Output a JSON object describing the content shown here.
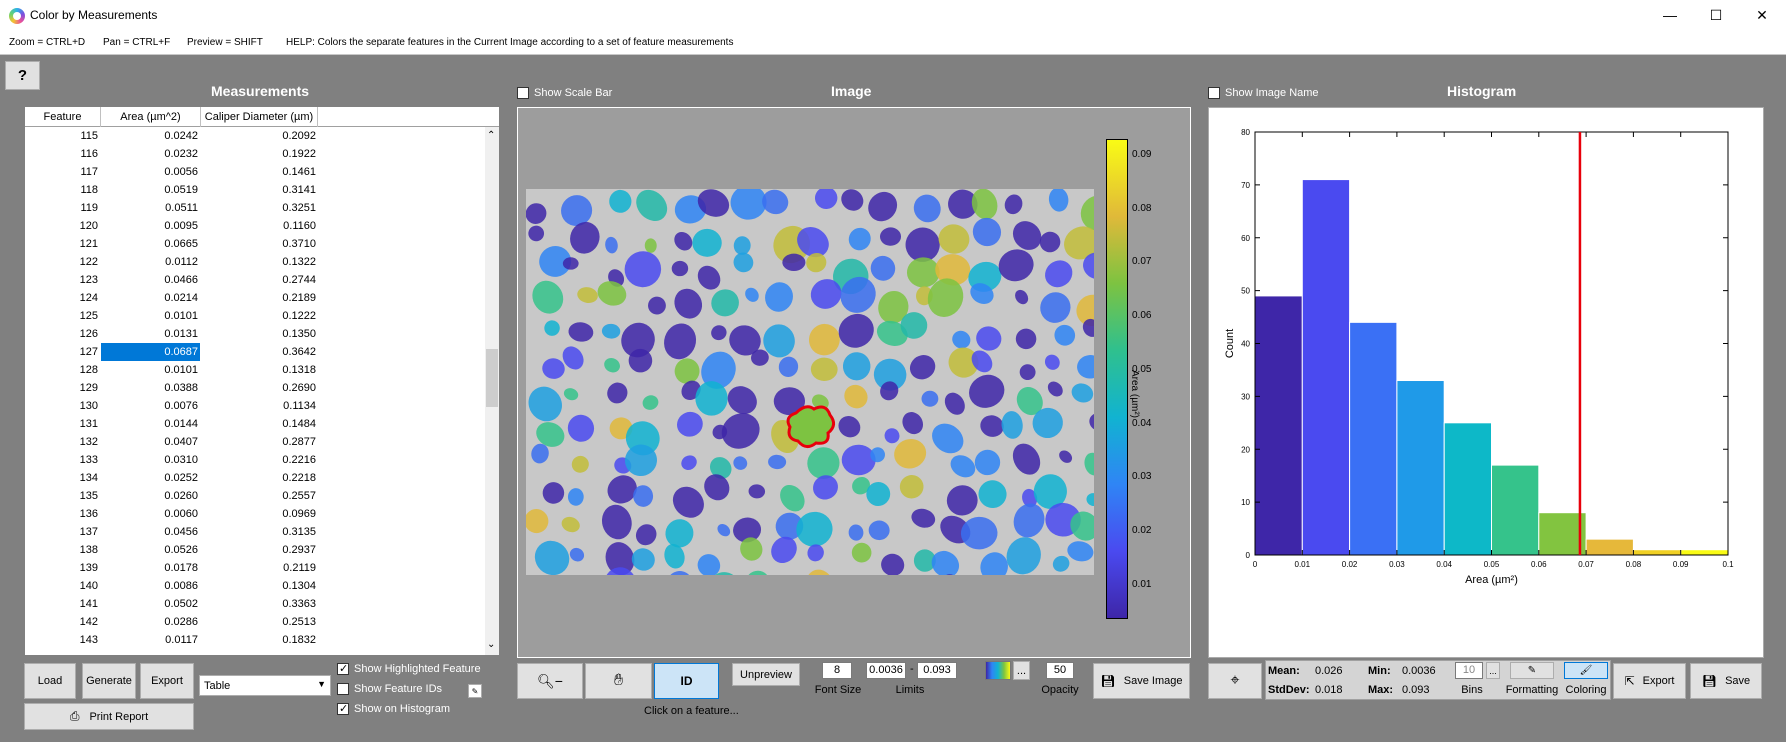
{
  "window": {
    "title": "Color by Measurements",
    "minimize": "—",
    "maximize": "☐",
    "close": "✕"
  },
  "hotkeys": {
    "zoom": "Zoom = CTRL+D",
    "pan": "Pan = CTRL+F",
    "preview": "Preview = SHIFT",
    "help": "HELP:  Colors the separate features in the Current Image according to a set of feature measurements"
  },
  "help_button": "?",
  "measurements": {
    "title": "Measurements",
    "columns": [
      "Feature",
      "Area (µm^2)",
      "Caliper Diameter (µm)"
    ],
    "rows": [
      [
        "115",
        "0.0242",
        "0.2092"
      ],
      [
        "116",
        "0.0232",
        "0.1922"
      ],
      [
        "117",
        "0.0056",
        "0.1461"
      ],
      [
        "118",
        "0.0519",
        "0.3141"
      ],
      [
        "119",
        "0.0511",
        "0.3251"
      ],
      [
        "120",
        "0.0095",
        "0.1160"
      ],
      [
        "121",
        "0.0665",
        "0.3710"
      ],
      [
        "122",
        "0.0112",
        "0.1322"
      ],
      [
        "123",
        "0.0466",
        "0.2744"
      ],
      [
        "124",
        "0.0214",
        "0.2189"
      ],
      [
        "125",
        "0.0101",
        "0.1222"
      ],
      [
        "126",
        "0.0131",
        "0.1350"
      ],
      [
        "127",
        "0.0687",
        "0.3642"
      ],
      [
        "128",
        "0.0101",
        "0.1318"
      ],
      [
        "129",
        "0.0388",
        "0.2690"
      ],
      [
        "130",
        "0.0076",
        "0.1134"
      ],
      [
        "131",
        "0.0144",
        "0.1484"
      ],
      [
        "132",
        "0.0407",
        "0.2877"
      ],
      [
        "133",
        "0.0310",
        "0.2216"
      ],
      [
        "134",
        "0.0252",
        "0.2218"
      ],
      [
        "135",
        "0.0260",
        "0.2557"
      ],
      [
        "136",
        "0.0060",
        "0.0969"
      ],
      [
        "137",
        "0.0456",
        "0.3135"
      ],
      [
        "138",
        "0.0526",
        "0.2937"
      ],
      [
        "139",
        "0.0178",
        "0.2119"
      ],
      [
        "140",
        "0.0086",
        "0.1304"
      ],
      [
        "141",
        "0.0502",
        "0.3363"
      ],
      [
        "142",
        "0.0286",
        "0.2513"
      ],
      [
        "143",
        "0.0117",
        "0.1832"
      ]
    ],
    "selected_row": "127",
    "buttons": {
      "load": "Load",
      "generate": "Generate",
      "export": "Export",
      "print": "Print Report"
    },
    "format_select": "Table",
    "options": {
      "show_highlighted": "Show Highlighted Feature",
      "show_ids": "Show Feature IDs",
      "show_on_histogram": "Show on Histogram"
    },
    "options_checked": {
      "show_highlighted": true,
      "show_ids": false,
      "show_on_histogram": true
    }
  },
  "image": {
    "title": "Image",
    "show_scale_bar": "Show Scale Bar",
    "colorbar_ticks": [
      "0.09",
      "0.08",
      "0.07",
      "0.06",
      "0.05",
      "0.04",
      "0.03",
      "0.02",
      "0.01"
    ],
    "colorbar_label": "Area (µm²)",
    "controls": {
      "id": "ID",
      "unpreview": "Unpreview",
      "font_size_value": "8",
      "font_size_label": "Font Size",
      "limit_low": "0.0036",
      "limit_dash": "-",
      "limit_high": "0.093",
      "limits_label": "Limits",
      "colormap_more": "...",
      "opacity_value": "50",
      "opacity_label": "Opacity",
      "save_image": "Save Image",
      "hint": "Click on a feature..."
    }
  },
  "histogram": {
    "title": "Histogram",
    "show_image_name": "Show Image Name",
    "stats": {
      "mean_label": "Mean:",
      "mean": "0.026",
      "stddev_label": "StdDev:",
      "stddev": "0.018",
      "min_label": "Min:",
      "min": "0.0036",
      "max_label": "Max:",
      "max": "0.093"
    },
    "bins_value": "10",
    "bins_more": "...",
    "bins_label": "Bins",
    "formatting_label": "Formatting",
    "coloring_label": "Coloring",
    "export": "Export",
    "save": "Save"
  },
  "colors": {
    "accent": "#0078d7",
    "marker": "#e8000b",
    "panel_bg": "#808080"
  },
  "chart_data": {
    "type": "bar",
    "xlabel": "Area (µm²)",
    "ylabel": "Count",
    "xlim": [
      0,
      0.1
    ],
    "ylim": [
      0,
      80
    ],
    "x_ticks": [
      "0",
      "0.01",
      "0.02",
      "0.03",
      "0.04",
      "0.05",
      "0.06",
      "0.07",
      "0.08",
      "0.09",
      "0.1"
    ],
    "y_ticks": [
      "0",
      "10",
      "20",
      "30",
      "40",
      "50",
      "60",
      "70",
      "80"
    ],
    "bin_edges": [
      0,
      0.01,
      0.02,
      0.03,
      0.04,
      0.05,
      0.06,
      0.07,
      0.08,
      0.09,
      0.1
    ],
    "values": [
      49,
      71,
      44,
      33,
      25,
      17,
      8,
      3,
      1,
      1
    ],
    "bar_colors": [
      "#3e26a8",
      "#4a4af0",
      "#3a70f5",
      "#1f9ae8",
      "#0db8c8",
      "#35c38b",
      "#82c440",
      "#e6b83a",
      "#f0d024",
      "#f9fb15"
    ],
    "marker_x": 0.0687,
    "grid": false
  }
}
